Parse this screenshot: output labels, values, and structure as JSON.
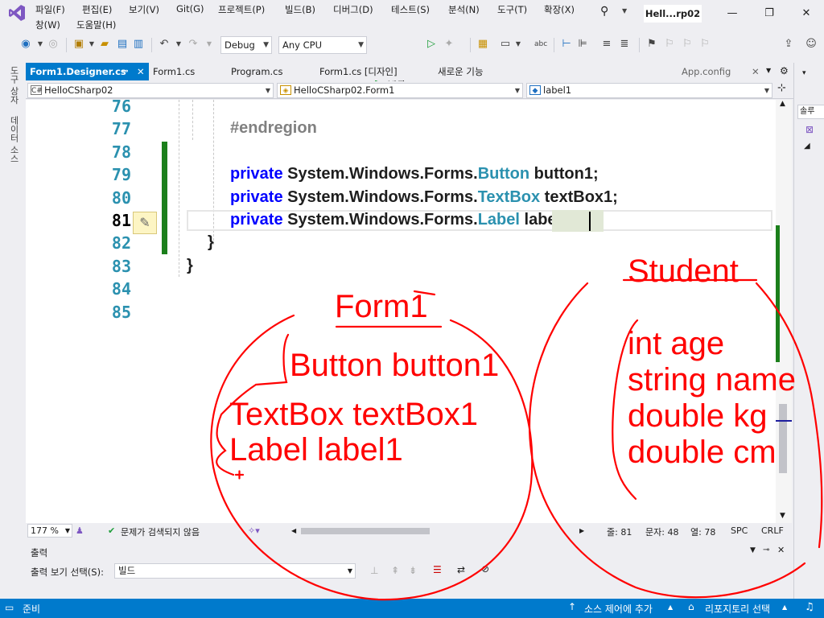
{
  "menu": {
    "row1": [
      "파일(F)",
      "편집(E)",
      "보기(V)",
      "Git(G)",
      "프로젝트(P)",
      "빌드(B)",
      "디버그(D)",
      "테스트(S)",
      "분석(N)",
      "도구(T)",
      "확장(X)"
    ],
    "row2": [
      "창(W)",
      "도움말(H)"
    ],
    "title": "Hell...rp02"
  },
  "toolbar": {
    "config": "Debug",
    "platform": "Any CPU",
    "start_label": "시작"
  },
  "left_strip": {
    "toolbox": "도구 상자",
    "datasource": "데이터 소스"
  },
  "tabs": [
    {
      "label": "Form1.Designer.cs",
      "active": true
    },
    {
      "label": "Form1.cs"
    },
    {
      "label": "Program.cs"
    },
    {
      "label": "Form1.cs [디자인]"
    },
    {
      "label": "새로운 기능"
    },
    {
      "label": "App.config"
    }
  ],
  "navbar": {
    "project": "HelloCSharp02",
    "class": "HelloCSharp02.Form1",
    "member": "label1"
  },
  "code": {
    "lines": [
      "76",
      "77",
      "78",
      "79",
      "80",
      "81",
      "82",
      "83",
      "84",
      "85"
    ],
    "current_line": "81",
    "endregion": "#endregion",
    "kw": "private",
    "ns": "System.Windows.Forms.",
    "l79_type": "Button",
    "l79_name": " button1;",
    "l80_type": "TextBox",
    "l80_name": " textBox1;",
    "l81_type": "Label",
    "l81_name": " label1;",
    "brace_close": "}"
  },
  "editor_status": {
    "zoom": "177 %",
    "issues": "문제가 검색되지 않음",
    "line": "줄: 81",
    "char": "문자: 48",
    "col": "열: 78",
    "spc": "SPC",
    "crlf": "CRLF"
  },
  "output": {
    "title": "출력",
    "source_label": "출력 보기 선택(S):",
    "source_value": "빌드"
  },
  "statusbar": {
    "ready": "준비",
    "source_control": "소스 제어에 추가",
    "repo": "리포지토리 선택"
  },
  "right_panel": {
    "search_hint": "솔루"
  },
  "annotation": {
    "form_title": "Form1",
    "form_items": [
      "Button button1",
      "TextBox textBox1",
      "Label label1"
    ],
    "class_title": "Student",
    "class_items": [
      "int age",
      "string name",
      "double kg",
      "double cm"
    ],
    "ink_color": "#ff0000"
  }
}
